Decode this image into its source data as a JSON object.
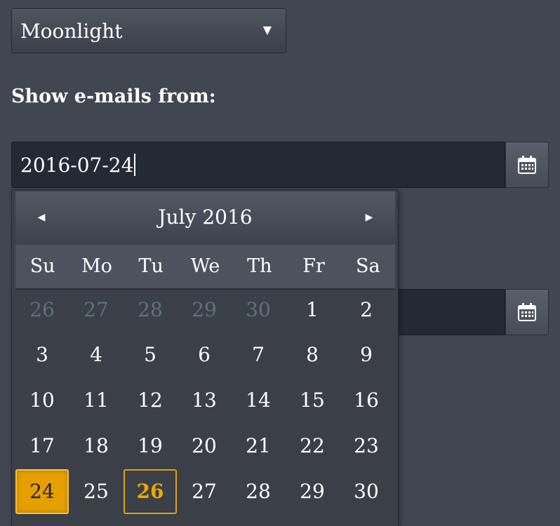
{
  "theme_select": {
    "value": "Moonlight"
  },
  "filter": {
    "label": "Show e-mails from:"
  },
  "date_from": {
    "value": "2016-07-24",
    "icon": "calendar-icon"
  },
  "date_to": {
    "value": "",
    "icon": "calendar-icon"
  },
  "calendar": {
    "title": "July 2016",
    "prev_icon": "prev-month-arrow",
    "next_icon": "next-month-arrow",
    "weekdays": [
      "Su",
      "Mo",
      "Tu",
      "We",
      "Th",
      "Fr",
      "Sa"
    ],
    "weeks": [
      [
        "26",
        "27",
        "28",
        "29",
        "30",
        "1",
        "2"
      ],
      [
        "3",
        "4",
        "5",
        "6",
        "7",
        "8",
        "9"
      ],
      [
        "10",
        "11",
        "12",
        "13",
        "14",
        "15",
        "16"
      ],
      [
        "17",
        "18",
        "19",
        "20",
        "21",
        "22",
        "23"
      ],
      [
        "24",
        "25",
        "26",
        "27",
        "28",
        "29",
        "30"
      ]
    ],
    "selected_day": "24",
    "today_day": "26"
  },
  "colors": {
    "background": "#424650",
    "accent": "#e5a000",
    "input_bg": "#232a33",
    "muted_day": "#5d7082"
  }
}
